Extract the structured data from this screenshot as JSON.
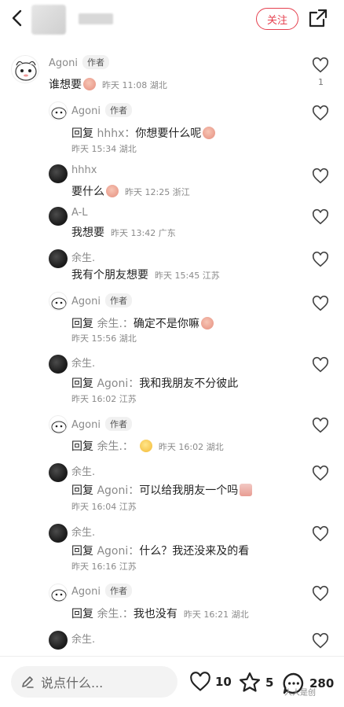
{
  "header": {
    "follow_label": "关注"
  },
  "comments": [
    {
      "user": "Agoni",
      "tag": "作者",
      "text": "谁想要",
      "time": "昨天 11:08 湖北",
      "likes": "1"
    },
    {
      "user": "Agoni",
      "tag": "作者",
      "reply_prefix": "回复",
      "reply_to": "hhhx：",
      "text": "你想要什么呢",
      "time": "昨天 15:34 湖北"
    },
    {
      "user": "hhhx",
      "text": "要什么",
      "time": "昨天 12:25 浙江"
    },
    {
      "user": "A-L",
      "text": "我想要",
      "time": "昨天 13:42 广东"
    },
    {
      "user": "余生.",
      "text": "我有个朋友想要",
      "time": "昨天 15:45 江苏"
    },
    {
      "user": "Agoni",
      "tag": "作者",
      "reply_prefix": "回复",
      "reply_to": "余生.：",
      "text": "确定不是你嘛",
      "time": "昨天 15:56 湖北"
    },
    {
      "user": "余生.",
      "reply_prefix": "回复",
      "reply_to": "Agoni：",
      "text": "我和我朋友不分彼此",
      "time": "昨天 16:02 江苏"
    },
    {
      "user": "Agoni",
      "tag": "作者",
      "reply_prefix": "回复",
      "reply_to": "余生.：",
      "text": "",
      "time": "昨天 16:02 湖北"
    },
    {
      "user": "余生.",
      "reply_prefix": "回复",
      "reply_to": "Agoni：",
      "text": "可以给我朋友一个吗",
      "time": "昨天 16:04 江苏"
    },
    {
      "user": "余生.",
      "reply_prefix": "回复",
      "reply_to": "Agoni：",
      "text": "什么？我还没来及的看",
      "time": "昨天 16:16 江苏"
    },
    {
      "user": "Agoni",
      "tag": "作者",
      "reply_prefix": "回复",
      "reply_to": "余生.：",
      "text": "我也没有",
      "time": "昨天 16:21 湖北"
    },
    {
      "user": "余生."
    }
  ],
  "bottom": {
    "input_placeholder": "说点什么...",
    "likes": "10",
    "favorites": "5",
    "comments": "280"
  },
  "watermark": "人人是创"
}
